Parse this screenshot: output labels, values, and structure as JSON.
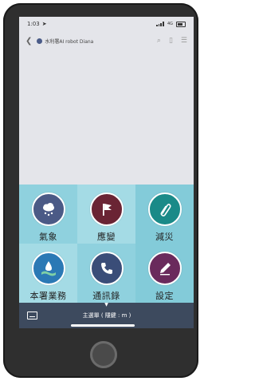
{
  "status_bar": {
    "time": "1:03",
    "network": "4G"
  },
  "header": {
    "title": "水利署AI robot Diana"
  },
  "menu": {
    "tiles": [
      {
        "label": "氣象",
        "icon": "cloud-rain-icon",
        "color": "#4b5a86"
      },
      {
        "label": "應變",
        "icon": "flag-icon",
        "color": "#6a2434"
      },
      {
        "label": "減災",
        "icon": "paperclip-icon",
        "color": "#1a8a88"
      },
      {
        "label": "本署業務",
        "icon": "water-drop-icon",
        "color": "#2b79b5"
      },
      {
        "label": "通訊錄",
        "icon": "phone-icon",
        "color": "#3a4d78"
      },
      {
        "label": "設定",
        "icon": "pen-icon",
        "color": "#6a2a5c"
      }
    ]
  },
  "bottom_bar": {
    "label": "主選單 ( 隱鍵 : m )"
  },
  "colors": {
    "screen_bg": "#e4e5ea",
    "bottom_bar_bg": "#3d4a5e",
    "tile_bg": "#8fd1de"
  }
}
